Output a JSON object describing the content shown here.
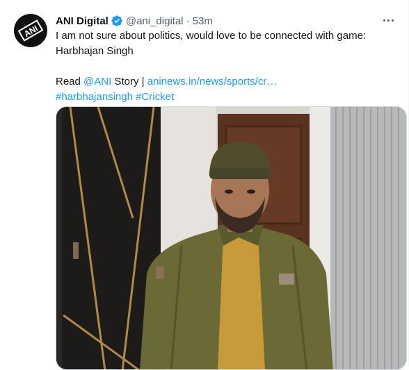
{
  "author": {
    "display_name": "ANI Digital",
    "handle": "@ani_digital",
    "separator": "·",
    "time": "53m",
    "avatar_text": "ANI",
    "verified_color": "#1d9bf0"
  },
  "tweet": {
    "line1": "I am not sure about politics, would love to be connected with game: Harbhajan Singh",
    "read_prefix": "Read ",
    "mention": "@ANI",
    "story_text": " Story | ",
    "url": "aninews.in/news/sports/cr…",
    "hashtag1": "#harbhajansingh",
    "hashtag2": "#Cricket"
  },
  "media": {
    "icon": "video-thumbnail"
  },
  "colors": {
    "link": "#1d9bf0",
    "text": "#0f1419",
    "muted": "#536471"
  }
}
